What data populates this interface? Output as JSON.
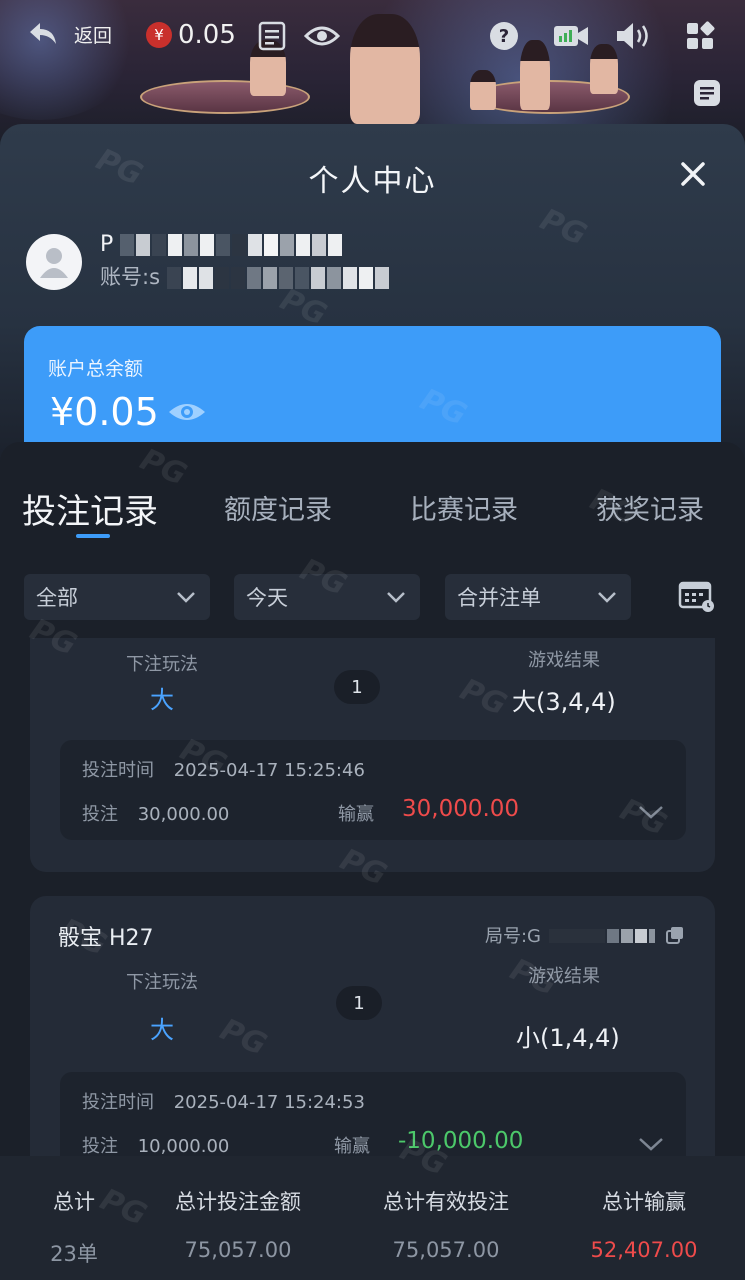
{
  "topbar": {
    "back_label": "返回",
    "balance_currency": "¥",
    "balance": "0.05",
    "icons": [
      "back-arrow-icon",
      "yen-coin-icon",
      "menu-list-icon",
      "eye-icon",
      "help-icon",
      "video-icon",
      "volume-icon",
      "apps-icon",
      "note-icon"
    ]
  },
  "panel": {
    "title": "个人中心",
    "close_icon": "close-icon"
  },
  "user": {
    "name_prefix": "P",
    "account_label": "账号:",
    "account_prefix": "s"
  },
  "balance_card": {
    "label": "账户总余额",
    "amount": "¥0.05",
    "color": "#3d9cf9"
  },
  "tabs": [
    {
      "label": "投注记录",
      "active": true
    },
    {
      "label": "额度记录",
      "active": false
    },
    {
      "label": "比赛记录",
      "active": false
    },
    {
      "label": "获奖记录",
      "active": false
    }
  ],
  "filters": {
    "type": "全部",
    "date": "今天",
    "merge": "合并注单"
  },
  "records": [
    {
      "game": "",
      "round_label": "",
      "bet_type_label": "下注玩法",
      "bet_type": "大",
      "count": "1",
      "result_label": "游戏结果",
      "result": "大(3,4,4)",
      "time_label": "投注时间",
      "time": "2025-04-17 15:25:46",
      "stake_label": "投注",
      "stake": "30,000.00",
      "winloss_label": "输赢",
      "winloss": "30,000.00"
    },
    {
      "game": "骰宝 H27",
      "round_label": "局号:G",
      "bet_type_label": "下注玩法",
      "bet_type": "大",
      "count": "1",
      "result_label": "游戏结果",
      "result": "小(1,4,4)",
      "time_label": "投注时间",
      "time": "2025-04-17 15:24:53",
      "stake_label": "投注",
      "stake": "10,000.00",
      "winloss_label": "输赢",
      "winloss": "-10,000.00"
    }
  ],
  "footer": {
    "total_label": "总计",
    "total_value": "23单",
    "bet_amount_label": "总计投注金额",
    "bet_amount_value": "75,057.00",
    "valid_bet_label": "总计有效投注",
    "valid_bet_value": "75,057.00",
    "winloss_label": "总计输赢",
    "winloss_value": "52,407.00"
  },
  "colors": {
    "accent_blue": "#3d9cf9",
    "win_red": "#ee4b4b",
    "loss_green": "#4cc86a"
  }
}
